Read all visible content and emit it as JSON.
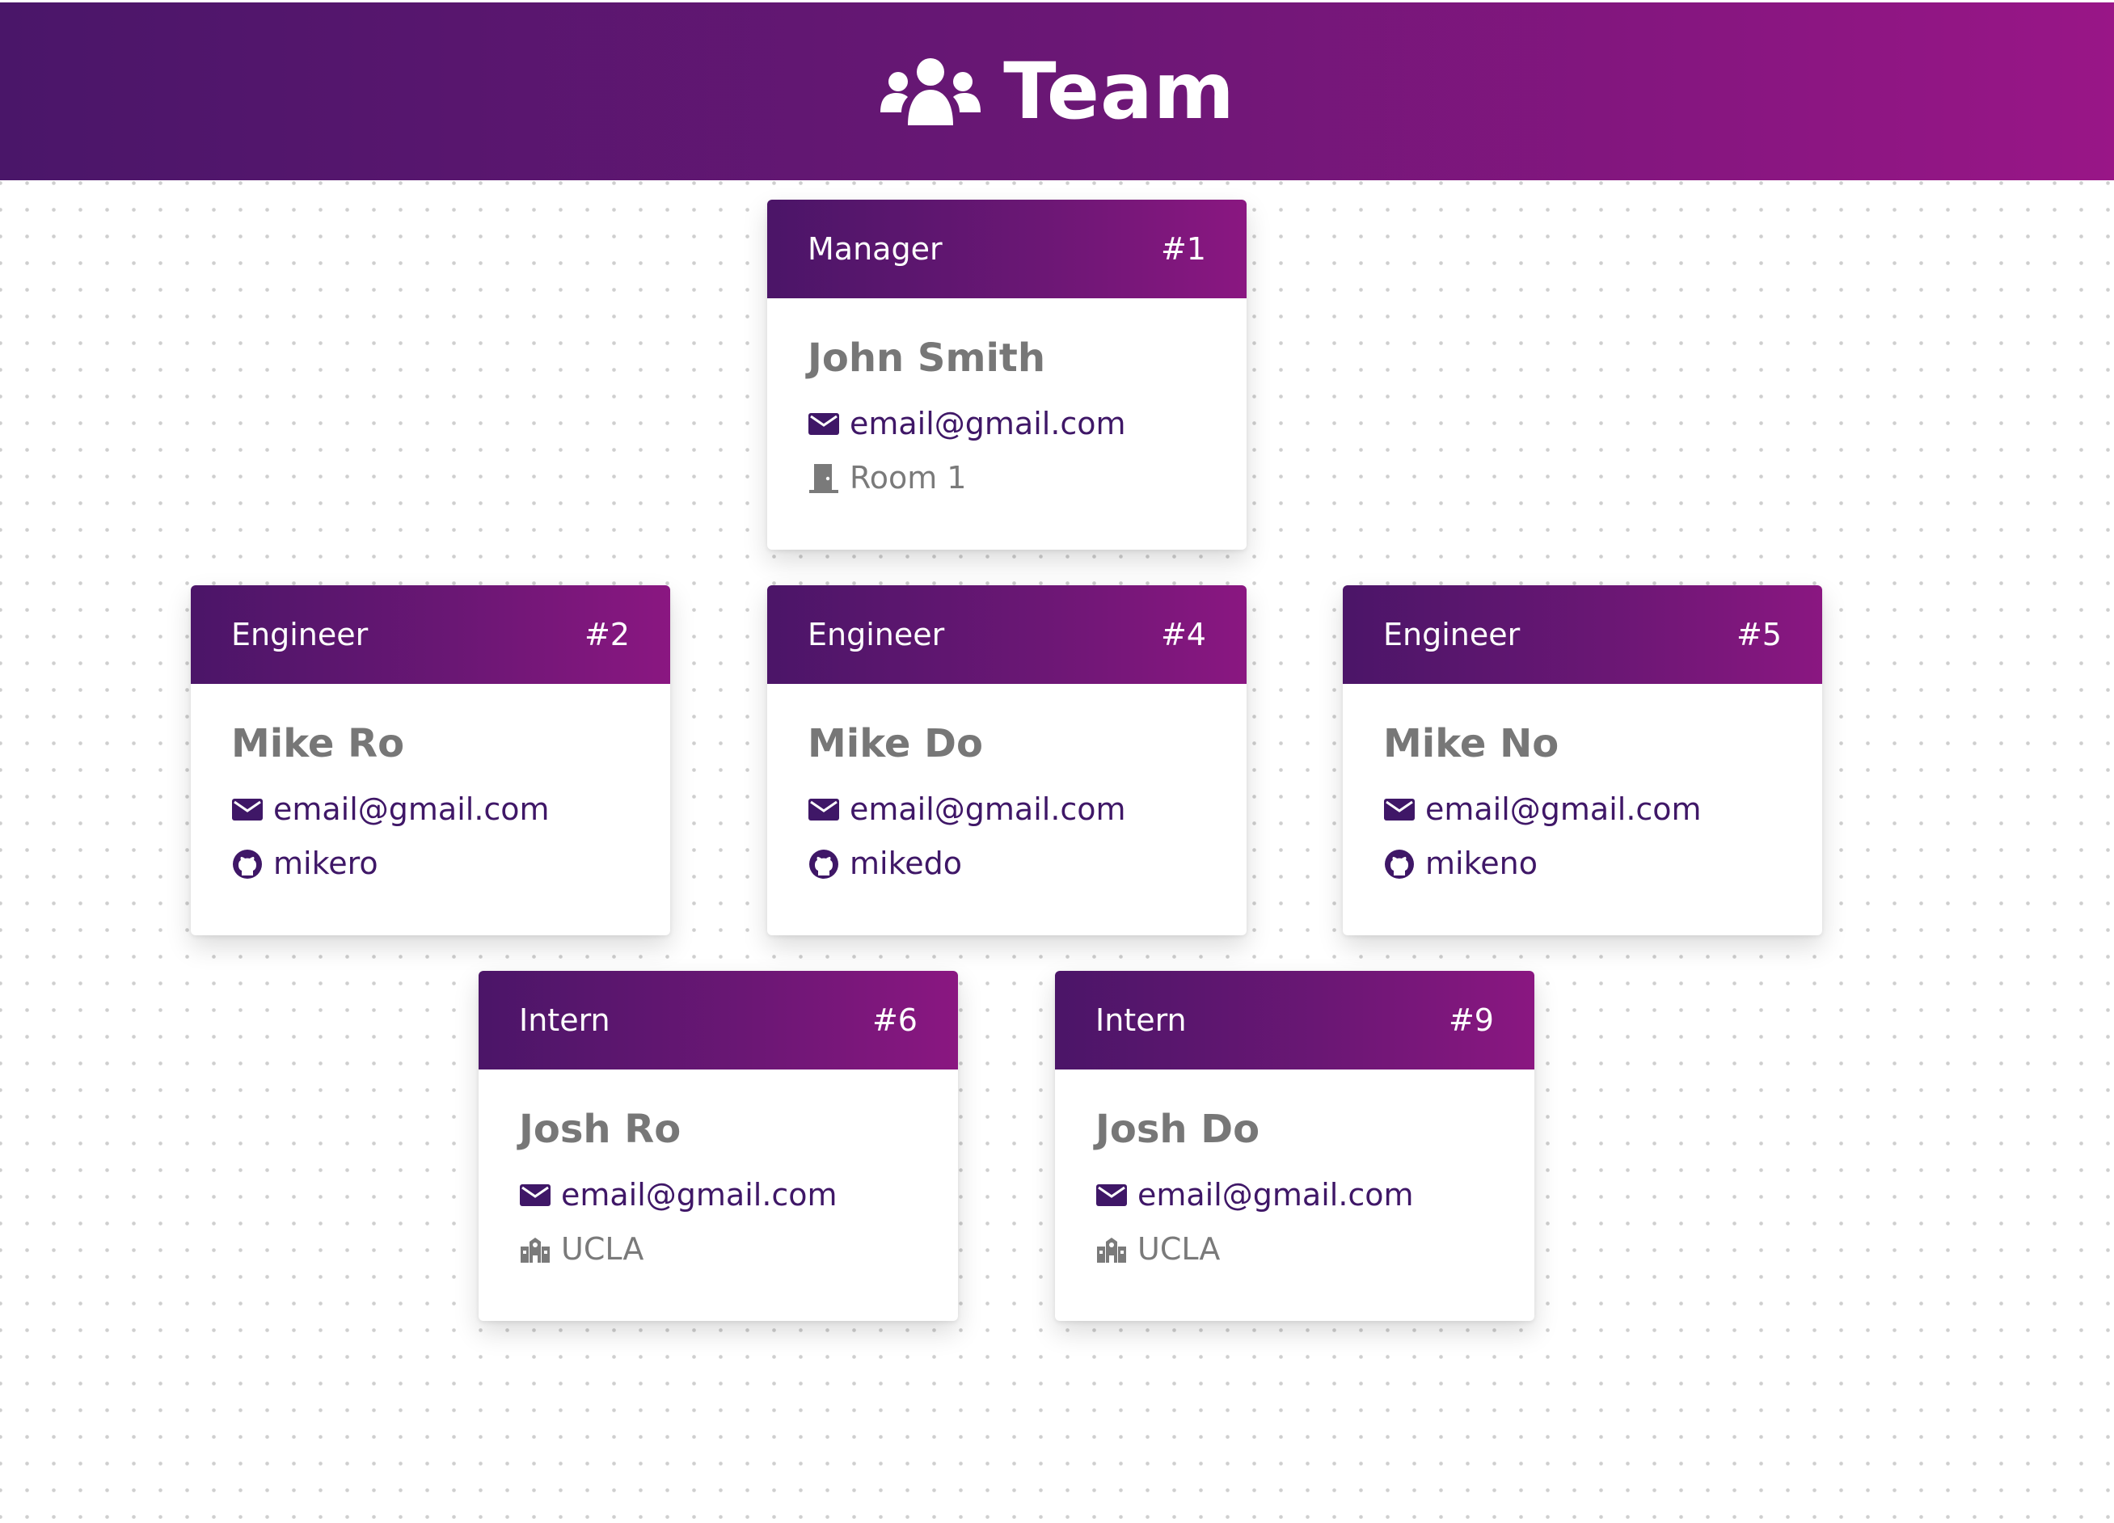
{
  "header": {
    "title": "Team",
    "icon": "users-icon",
    "gradient_start": "#4a1669",
    "gradient_end": "#991687"
  },
  "colors": {
    "accent": "#3f1767",
    "muted_text": "#777777"
  },
  "cards": [
    {
      "role": "Manager",
      "id": "#1",
      "name": "John Smith",
      "email": "email@gmail.com",
      "detail": "Room 1",
      "detail_icon": "door-icon"
    },
    {
      "role": "Engineer",
      "id": "#2",
      "name": "Mike Ro",
      "email": "email@gmail.com",
      "detail": "mikero",
      "detail_icon": "github-icon"
    },
    {
      "role": "Engineer",
      "id": "#4",
      "name": "Mike Do",
      "email": "email@gmail.com",
      "detail": "mikedo",
      "detail_icon": "github-icon"
    },
    {
      "role": "Engineer",
      "id": "#5",
      "name": "Mike No",
      "email": "email@gmail.com",
      "detail": "mikeno",
      "detail_icon": "github-icon"
    },
    {
      "role": "Intern",
      "id": "#6",
      "name": "Josh Ro",
      "email": "email@gmail.com",
      "detail": "UCLA",
      "detail_icon": "school-icon"
    },
    {
      "role": "Intern",
      "id": "#9",
      "name": "Josh Do",
      "email": "email@gmail.com",
      "detail": "UCLA",
      "detail_icon": "school-icon"
    }
  ]
}
